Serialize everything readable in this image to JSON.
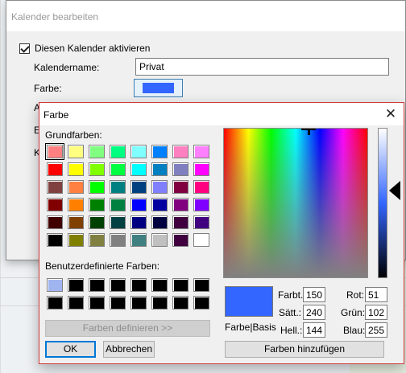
{
  "background": {
    "accent": "#3366ff"
  },
  "back_dialog": {
    "title": "Kalender bearbeiten",
    "activate_label": "Diesen Kalender aktivieren",
    "activate_checked": true,
    "name_label": "Kalendername:",
    "name_value": "Privat",
    "color_label": "Farbe:",
    "hidden_labels": [
      "A",
      "E",
      "K"
    ]
  },
  "color_dialog": {
    "title": "Farbe",
    "close_glyph": "✕",
    "basic_colors_label": "Grundfarben:",
    "basic_colors": [
      [
        "#ff8080",
        "#ffff80",
        "#80ff80",
        "#00ff80",
        "#80ffff",
        "#0080ff",
        "#ff80c0",
        "#ff80ff"
      ],
      [
        "#ff0000",
        "#ffff00",
        "#80ff00",
        "#00ff40",
        "#00ffff",
        "#0080c0",
        "#8080c0",
        "#ff00ff"
      ],
      [
        "#804040",
        "#ff8040",
        "#00ff00",
        "#008080",
        "#004080",
        "#8080ff",
        "#800040",
        "#ff0080"
      ],
      [
        "#800000",
        "#ff8000",
        "#008000",
        "#008040",
        "#0000ff",
        "#0000a0",
        "#800080",
        "#8000ff"
      ],
      [
        "#400000",
        "#804000",
        "#004000",
        "#004040",
        "#000080",
        "#000040",
        "#400040",
        "#400080"
      ],
      [
        "#000000",
        "#808000",
        "#808040",
        "#808080",
        "#408080",
        "#c0c0c0",
        "#400040",
        "#ffffff"
      ]
    ],
    "custom_colors_label": "Benutzerdefinierte Farben:",
    "custom_colors": [
      [
        "#a0b4f0",
        "#000000",
        "#000000",
        "#000000",
        "#000000",
        "#000000",
        "#000000",
        "#000000"
      ],
      [
        "#000000",
        "#000000",
        "#000000",
        "#000000",
        "#000000",
        "#000000",
        "#000000",
        "#000000"
      ]
    ],
    "define_button": "Farben definieren >>",
    "ok_button": "OK",
    "cancel_button": "Abbrechen",
    "preview_color": "#3366ff",
    "preview_label": "Farbe|Basis",
    "fields": {
      "hue_label": "Farbt.:",
      "hue": "150",
      "sat_label": "Sätt.:",
      "sat": "240",
      "lum_label": "Hell.:",
      "lum": "144",
      "red_label": "Rot:",
      "red": "51",
      "green_label": "Grün:",
      "green": "102",
      "blue_label": "Blau:",
      "blue": "255"
    },
    "add_button": "Farben hinzufügen"
  }
}
